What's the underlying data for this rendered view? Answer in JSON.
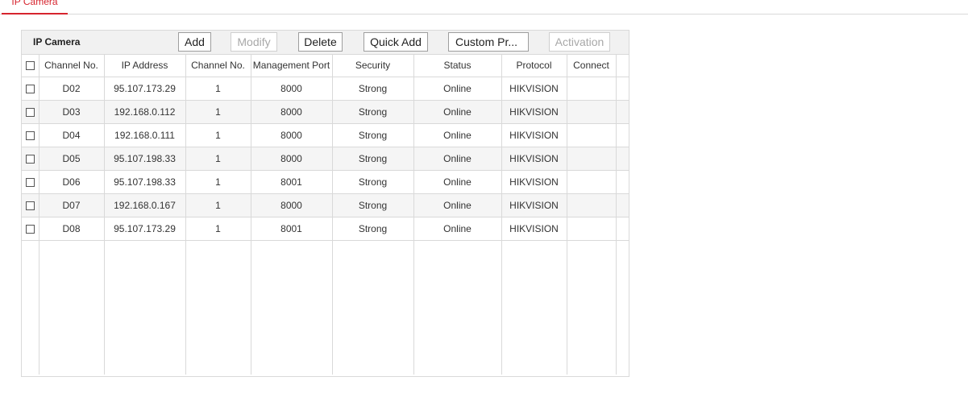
{
  "tab": {
    "label": "IP Camera"
  },
  "toolbar": {
    "title": "IP Camera",
    "add": "Add",
    "modify": "Modify",
    "delete": "Delete",
    "quick_add": "Quick Add",
    "custom_protocol": "Custom Pr...",
    "activation": "Activation"
  },
  "table": {
    "headers": [
      "Channel No.",
      "IP Address",
      "Channel No.",
      "Management Port",
      "Security",
      "Status",
      "Protocol",
      "Connect"
    ],
    "rows": [
      [
        "D02",
        "95.107.173.29",
        "1",
        "8000",
        "Strong",
        "Online",
        "HIKVISION",
        ""
      ],
      [
        "D03",
        "192.168.0.112",
        "1",
        "8000",
        "Strong",
        "Online",
        "HIKVISION",
        ""
      ],
      [
        "D04",
        "192.168.0.111",
        "1",
        "8000",
        "Strong",
        "Online",
        "HIKVISION",
        ""
      ],
      [
        "D05",
        "95.107.198.33",
        "1",
        "8000",
        "Strong",
        "Online",
        "HIKVISION",
        ""
      ],
      [
        "D06",
        "95.107.198.33",
        "1",
        "8001",
        "Strong",
        "Online",
        "HIKVISION",
        ""
      ],
      [
        "D07",
        "192.168.0.167",
        "1",
        "8000",
        "Strong",
        "Online",
        "HIKVISION",
        ""
      ],
      [
        "D08",
        "95.107.173.29",
        "1",
        "8001",
        "Strong",
        "Online",
        "HIKVISION",
        ""
      ]
    ]
  },
  "colors": {
    "accent": "#d6242e",
    "border": "#d9d9d9",
    "toolbar_bg": "#f1f1f1",
    "alt_row": "#f5f5f5"
  }
}
